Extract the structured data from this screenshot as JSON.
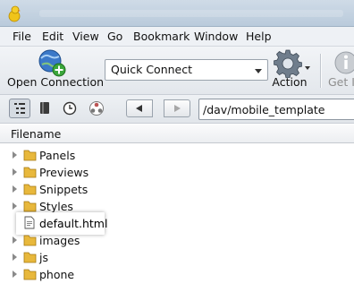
{
  "menu": [
    "File",
    "Edit",
    "View",
    "Go",
    "Bookmark",
    "Window",
    "Help"
  ],
  "toolbar": {
    "open_connection_label": "Open Connection",
    "quick_connect_value": "Quick Connect",
    "action_label": "Action",
    "get_info_label": "Get In"
  },
  "nav": {
    "path_value": "/dav/mobile_template"
  },
  "columns": {
    "filename": "Filename"
  },
  "files": [
    {
      "name": "Panels",
      "type": "folder"
    },
    {
      "name": "Previews",
      "type": "folder"
    },
    {
      "name": "Snippets",
      "type": "folder"
    },
    {
      "name": "Styles",
      "type": "folder"
    },
    {
      "name": "default.html",
      "type": "file"
    },
    {
      "name": "images",
      "type": "folder"
    },
    {
      "name": "js",
      "type": "folder"
    },
    {
      "name": "phone",
      "type": "folder"
    }
  ],
  "colors": {
    "folder": "#e8b83c",
    "accent_globe": "#3b79c9",
    "plus_badge": "#3aa63a"
  }
}
